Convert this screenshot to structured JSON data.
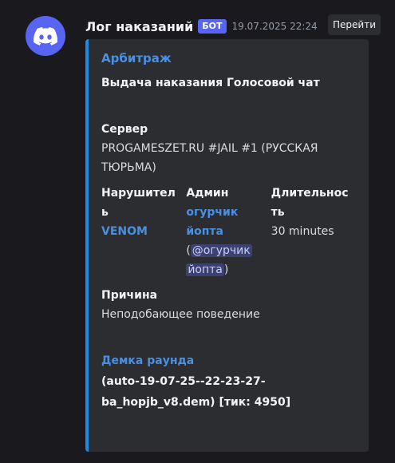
{
  "message": {
    "author": "Лог наказаний",
    "bot_tag": "БОТ",
    "timestamp": "19.07.2025 22:24",
    "goto_label": "Перейти",
    "avatar_icon": "discord-logo-icon"
  },
  "embed": {
    "accent_color": "#1e88e5",
    "title": "Арбитраж",
    "description": "Выдача наказания Голосовой чат",
    "server": {
      "name": "Сервер",
      "value_line1": "PROGAMESZET.RU #JAIL #1 (РУССКАЯ",
      "value_line2": "ТЮРЬМА)"
    },
    "violator": {
      "name_line1": "Нарушитель",
      "name_line2": "ь",
      "value": "VENOM"
    },
    "admin": {
      "name": "Админ",
      "value_line1": "огурчик",
      "value_line2": "йопта",
      "mention_line1": "@огурчик",
      "mention_line2": "йопта",
      "paren_open": "(",
      "paren_close": ")"
    },
    "duration": {
      "name_line1": "Длительнос",
      "name_line2": "ть",
      "value": "30 minutes"
    },
    "reason": {
      "name": "Причина",
      "value": "Неподобающее поведение"
    },
    "demo": {
      "title": "Демка раунда",
      "value_line1": "(auto-19-07-25--22-23-27-",
      "value_line2": "ba_hopjb_v8.dem) [тик: 4950]"
    }
  }
}
